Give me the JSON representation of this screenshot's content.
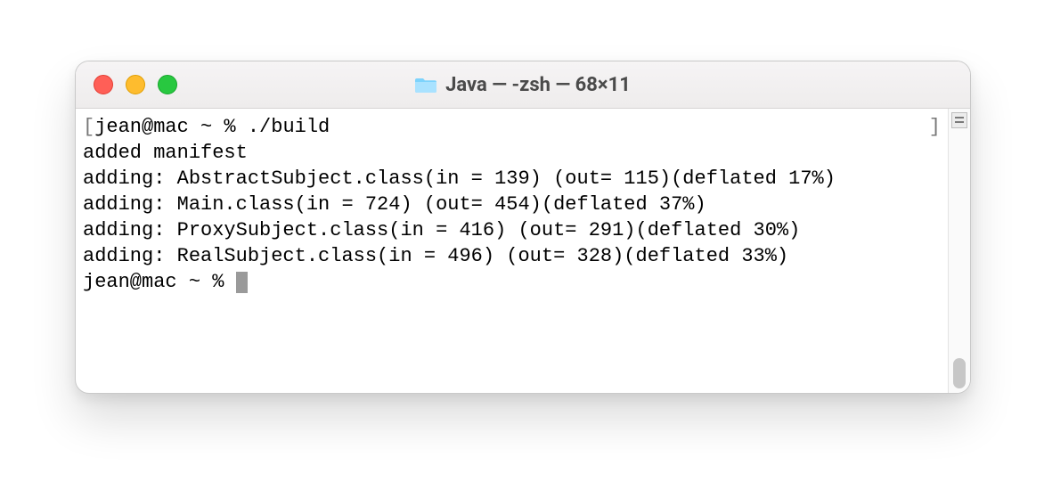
{
  "window": {
    "title": "Java — -zsh — 68×11"
  },
  "terminal": {
    "prompt_open": "[",
    "prompt_close": "]",
    "prompt1": "jean@mac ~ % ./build",
    "lines": [
      "added manifest",
      "adding: AbstractSubject.class(in = 139) (out= 115)(deflated 17%)",
      "adding: Main.class(in = 724) (out= 454)(deflated 37%)",
      "adding: ProxySubject.class(in = 416) (out= 291)(deflated 30%)",
      "adding: RealSubject.class(in = 496) (out= 328)(deflated 33%)"
    ],
    "prompt2": "jean@mac ~ % "
  }
}
